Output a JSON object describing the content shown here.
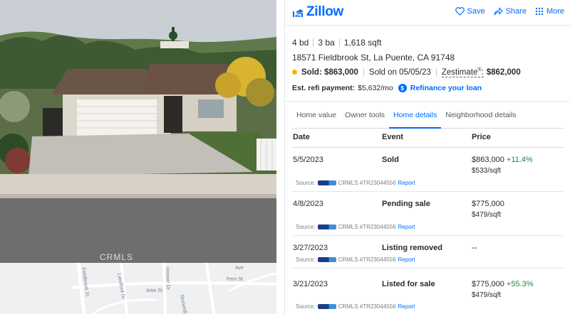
{
  "photo": {
    "watermark": "CRMLS"
  },
  "map": {
    "streets": [
      "Fieldbrook St",
      "Landford Dr",
      "Hooser Dr",
      "Artie St",
      "Fern St",
      "Stonehill Dr",
      "Ave"
    ]
  },
  "header": {
    "logo_text": "Zillow",
    "actions": {
      "save": "Save",
      "share": "Share",
      "more": "More"
    }
  },
  "facts": {
    "beds": "4 bd",
    "baths": "3 ba",
    "sqft": "1,618 sqft"
  },
  "address": "18571 Fieldbrook St, La Puente, CA 91748",
  "status": {
    "sold_label": "Sold: $863,000",
    "sold_on": "Sold on 05/05/23",
    "zestimate_label": "Zestimate",
    "zestimate_mark": "®",
    "zestimate_colon": ":",
    "zestimate_value": "$862,000",
    "status_color": "#f6b400"
  },
  "refi": {
    "label": "Est. refi payment:",
    "value": "$5,632/mo",
    "icon": "$",
    "link": "Refinance your loan"
  },
  "tabs": [
    {
      "label": "Home value",
      "active": false
    },
    {
      "label": "Owner tools",
      "active": false
    },
    {
      "label": "Home details",
      "active": true
    },
    {
      "label": "Neighborhood details",
      "active": false
    }
  ],
  "table": {
    "headers": {
      "date": "Date",
      "event": "Event",
      "price": "Price"
    },
    "rows": [
      {
        "date": "5/5/2023",
        "event": "Sold",
        "price": "$863,000",
        "change": "+11.4%",
        "sqft": "$533/sqft",
        "source_label": "Source:",
        "source_id": "CRMLS #TR23044556",
        "report": "Report"
      },
      {
        "date": "4/8/2023",
        "event": "Pending sale",
        "price": "$775,000",
        "change": "",
        "sqft": "$479/sqft",
        "source_label": "Source:",
        "source_id": "CRMLS #TR23044556",
        "report": "Report"
      },
      {
        "date": "3/27/2023",
        "event": "Listing removed",
        "price": "--",
        "change": "",
        "sqft": "",
        "source_label": "Source:",
        "source_id": "CRMLS #TR23044556",
        "report": "Report"
      },
      {
        "date": "3/21/2023",
        "event": "Listed for sale",
        "price": "$775,000",
        "change": "+55.3%",
        "sqft": "$479/sqft",
        "source_label": "Source:",
        "source_id": "CRMLS #TR23044556",
        "report": "Report"
      }
    ]
  },
  "colors": {
    "brand": "#006aff",
    "positive": "#1a8a3c"
  }
}
